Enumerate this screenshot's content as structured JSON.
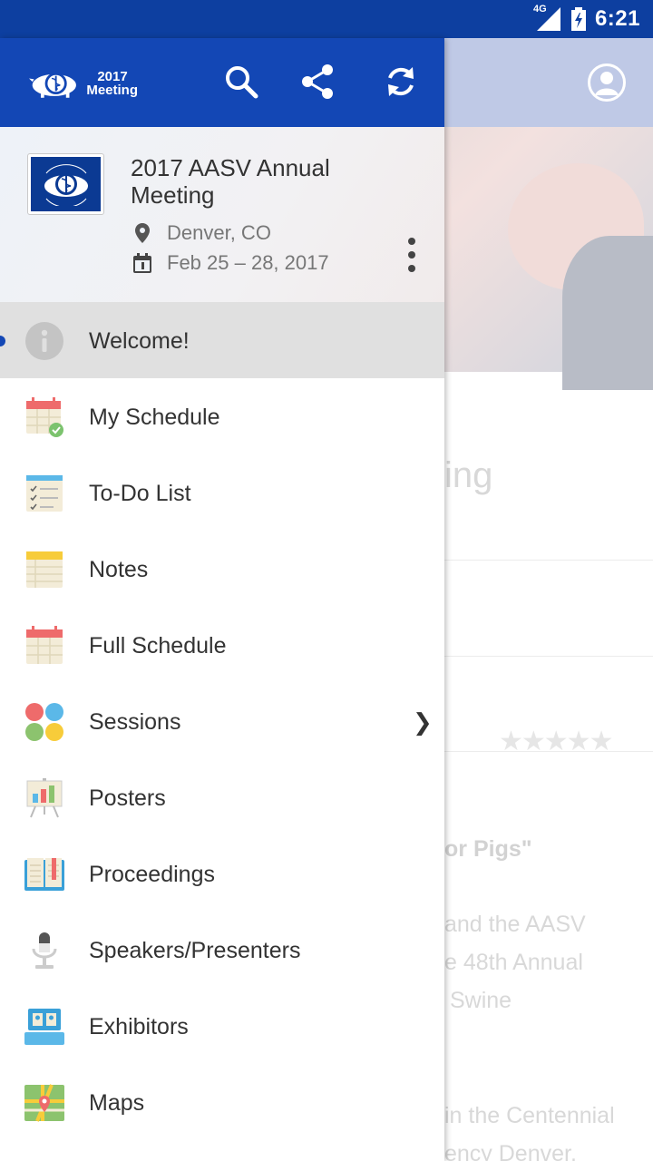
{
  "status_bar": {
    "network": "4G",
    "time": "6:21"
  },
  "background": {
    "title_fragment": "ing",
    "subtitle_fragment": "or Pigs\"",
    "body_lines": [
      "and the AASV",
      "e 48th Annual",
      "Swine"
    ],
    "body_lines_2": [
      "in the Centennial",
      "ency Denver."
    ]
  },
  "drawer": {
    "logo": {
      "year": "2017",
      "word": "Meeting"
    },
    "event": {
      "title": "2017 AASV Annual Meeting",
      "location": "Denver, CO",
      "dates": "Feb 25 – 28, 2017"
    },
    "menu": [
      {
        "label": "Welcome!",
        "icon": "info-icon",
        "active": true
      },
      {
        "label": "My Schedule",
        "icon": "calendar-check-icon"
      },
      {
        "label": "To-Do List",
        "icon": "checklist-icon"
      },
      {
        "label": "Notes",
        "icon": "notepad-icon"
      },
      {
        "label": "Full Schedule",
        "icon": "calendar-icon"
      },
      {
        "label": "Sessions",
        "icon": "dots-grid-icon",
        "has_submenu": true
      },
      {
        "label": "Posters",
        "icon": "easel-chart-icon"
      },
      {
        "label": "Proceedings",
        "icon": "book-icon"
      },
      {
        "label": "Speakers/Presenters",
        "icon": "microphone-icon"
      },
      {
        "label": "Exhibitors",
        "icon": "booth-icon"
      },
      {
        "label": "Maps",
        "icon": "map-icon"
      }
    ]
  },
  "colors": {
    "primary": "#1347b5",
    "status_bar": "#0d3fa0",
    "active_row": "#e0e0e0"
  }
}
